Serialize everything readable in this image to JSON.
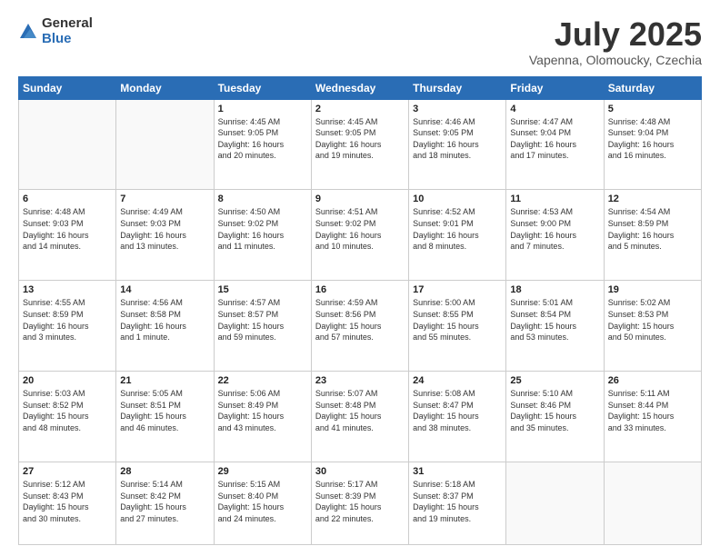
{
  "logo": {
    "general": "General",
    "blue": "Blue"
  },
  "header": {
    "month": "July 2025",
    "location": "Vapenna, Olomoucky, Czechia"
  },
  "weekdays": [
    "Sunday",
    "Monday",
    "Tuesday",
    "Wednesday",
    "Thursday",
    "Friday",
    "Saturday"
  ],
  "weeks": [
    [
      {
        "day": "",
        "info": ""
      },
      {
        "day": "",
        "info": ""
      },
      {
        "day": "1",
        "info": "Sunrise: 4:45 AM\nSunset: 9:05 PM\nDaylight: 16 hours\nand 20 minutes."
      },
      {
        "day": "2",
        "info": "Sunrise: 4:45 AM\nSunset: 9:05 PM\nDaylight: 16 hours\nand 19 minutes."
      },
      {
        "day": "3",
        "info": "Sunrise: 4:46 AM\nSunset: 9:05 PM\nDaylight: 16 hours\nand 18 minutes."
      },
      {
        "day": "4",
        "info": "Sunrise: 4:47 AM\nSunset: 9:04 PM\nDaylight: 16 hours\nand 17 minutes."
      },
      {
        "day": "5",
        "info": "Sunrise: 4:48 AM\nSunset: 9:04 PM\nDaylight: 16 hours\nand 16 minutes."
      }
    ],
    [
      {
        "day": "6",
        "info": "Sunrise: 4:48 AM\nSunset: 9:03 PM\nDaylight: 16 hours\nand 14 minutes."
      },
      {
        "day": "7",
        "info": "Sunrise: 4:49 AM\nSunset: 9:03 PM\nDaylight: 16 hours\nand 13 minutes."
      },
      {
        "day": "8",
        "info": "Sunrise: 4:50 AM\nSunset: 9:02 PM\nDaylight: 16 hours\nand 11 minutes."
      },
      {
        "day": "9",
        "info": "Sunrise: 4:51 AM\nSunset: 9:02 PM\nDaylight: 16 hours\nand 10 minutes."
      },
      {
        "day": "10",
        "info": "Sunrise: 4:52 AM\nSunset: 9:01 PM\nDaylight: 16 hours\nand 8 minutes."
      },
      {
        "day": "11",
        "info": "Sunrise: 4:53 AM\nSunset: 9:00 PM\nDaylight: 16 hours\nand 7 minutes."
      },
      {
        "day": "12",
        "info": "Sunrise: 4:54 AM\nSunset: 8:59 PM\nDaylight: 16 hours\nand 5 minutes."
      }
    ],
    [
      {
        "day": "13",
        "info": "Sunrise: 4:55 AM\nSunset: 8:59 PM\nDaylight: 16 hours\nand 3 minutes."
      },
      {
        "day": "14",
        "info": "Sunrise: 4:56 AM\nSunset: 8:58 PM\nDaylight: 16 hours\nand 1 minute."
      },
      {
        "day": "15",
        "info": "Sunrise: 4:57 AM\nSunset: 8:57 PM\nDaylight: 15 hours\nand 59 minutes."
      },
      {
        "day": "16",
        "info": "Sunrise: 4:59 AM\nSunset: 8:56 PM\nDaylight: 15 hours\nand 57 minutes."
      },
      {
        "day": "17",
        "info": "Sunrise: 5:00 AM\nSunset: 8:55 PM\nDaylight: 15 hours\nand 55 minutes."
      },
      {
        "day": "18",
        "info": "Sunrise: 5:01 AM\nSunset: 8:54 PM\nDaylight: 15 hours\nand 53 minutes."
      },
      {
        "day": "19",
        "info": "Sunrise: 5:02 AM\nSunset: 8:53 PM\nDaylight: 15 hours\nand 50 minutes."
      }
    ],
    [
      {
        "day": "20",
        "info": "Sunrise: 5:03 AM\nSunset: 8:52 PM\nDaylight: 15 hours\nand 48 minutes."
      },
      {
        "day": "21",
        "info": "Sunrise: 5:05 AM\nSunset: 8:51 PM\nDaylight: 15 hours\nand 46 minutes."
      },
      {
        "day": "22",
        "info": "Sunrise: 5:06 AM\nSunset: 8:49 PM\nDaylight: 15 hours\nand 43 minutes."
      },
      {
        "day": "23",
        "info": "Sunrise: 5:07 AM\nSunset: 8:48 PM\nDaylight: 15 hours\nand 41 minutes."
      },
      {
        "day": "24",
        "info": "Sunrise: 5:08 AM\nSunset: 8:47 PM\nDaylight: 15 hours\nand 38 minutes."
      },
      {
        "day": "25",
        "info": "Sunrise: 5:10 AM\nSunset: 8:46 PM\nDaylight: 15 hours\nand 35 minutes."
      },
      {
        "day": "26",
        "info": "Sunrise: 5:11 AM\nSunset: 8:44 PM\nDaylight: 15 hours\nand 33 minutes."
      }
    ],
    [
      {
        "day": "27",
        "info": "Sunrise: 5:12 AM\nSunset: 8:43 PM\nDaylight: 15 hours\nand 30 minutes."
      },
      {
        "day": "28",
        "info": "Sunrise: 5:14 AM\nSunset: 8:42 PM\nDaylight: 15 hours\nand 27 minutes."
      },
      {
        "day": "29",
        "info": "Sunrise: 5:15 AM\nSunset: 8:40 PM\nDaylight: 15 hours\nand 24 minutes."
      },
      {
        "day": "30",
        "info": "Sunrise: 5:17 AM\nSunset: 8:39 PM\nDaylight: 15 hours\nand 22 minutes."
      },
      {
        "day": "31",
        "info": "Sunrise: 5:18 AM\nSunset: 8:37 PM\nDaylight: 15 hours\nand 19 minutes."
      },
      {
        "day": "",
        "info": ""
      },
      {
        "day": "",
        "info": ""
      }
    ]
  ]
}
